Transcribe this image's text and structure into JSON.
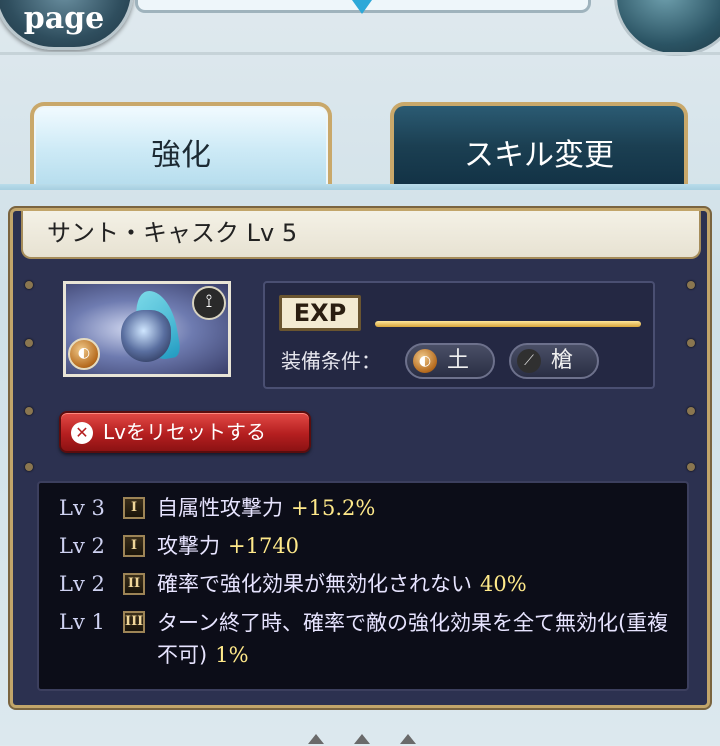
{
  "topbar": {
    "page_label": "page",
    "icons": {
      "right": "round-menu-icon",
      "center": "down-arrow-icon"
    }
  },
  "tabs": [
    {
      "label": "強化",
      "active": true
    },
    {
      "label": "スキル変更",
      "active": false
    }
  ],
  "weapon": {
    "title": "サント・キャスク Lv 5",
    "icons": {
      "type": "spear-icon",
      "element": "earth-element-icon"
    }
  },
  "exp": {
    "label": "EXP",
    "progress_percent": 100
  },
  "equip_conditions": {
    "label": "装備条件：",
    "element": "土",
    "weapon_type": "槍"
  },
  "reset_button": {
    "label": "Lvをリセットする"
  },
  "skills": [
    {
      "level": "Lv 3",
      "rank": "I",
      "name": "自属性攻撃力",
      "value": "+15.2%"
    },
    {
      "level": "Lv 2",
      "rank": "I",
      "name": "攻撃力",
      "value": "+1740"
    },
    {
      "level": "Lv 2",
      "rank": "II",
      "name": "確率で強化効果が無効化されない",
      "value": "40%"
    },
    {
      "level": "Lv 1",
      "rank": "III",
      "name": "ターン終了時、確率で敵の強化効果を全て無効化(重複不可)",
      "value": "1%"
    }
  ],
  "colors": {
    "panel_bg": "#2c3150",
    "gold_border": "#c2a56a",
    "exp_bar": "#e8c15a",
    "reset_button": "#c72a28",
    "skill_value": "#ffe98a"
  }
}
